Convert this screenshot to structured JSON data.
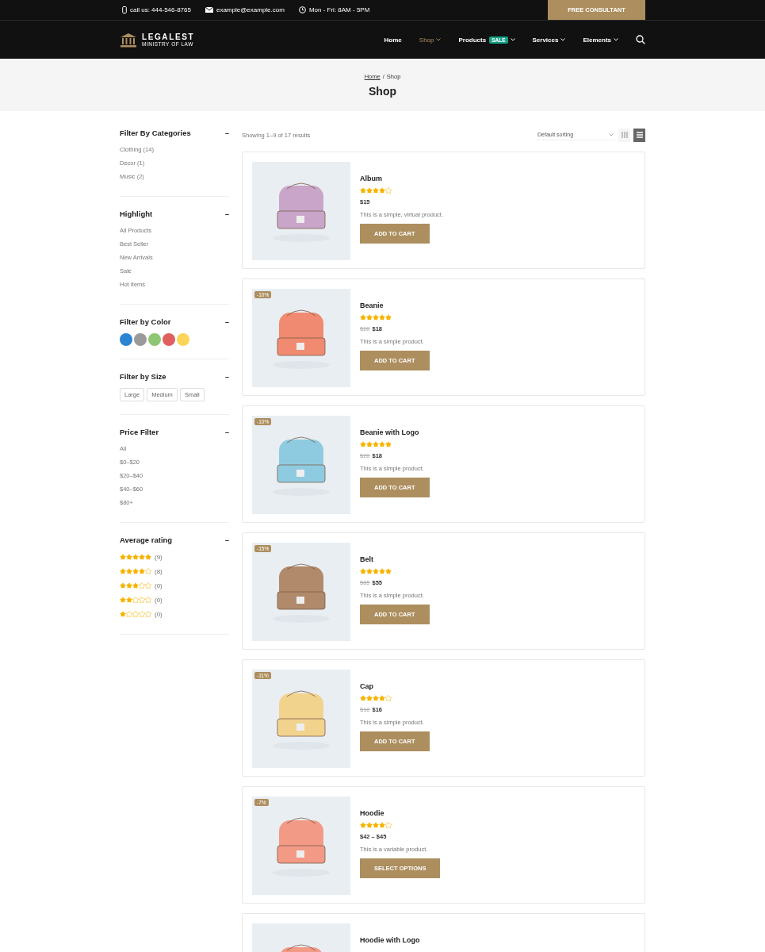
{
  "topbar": {
    "phone": "call us: 444-546-8765",
    "email": "example@example.com",
    "hours": "Mon - Fri: 8AM - 5PM",
    "cta": "FREE CONSULTANT"
  },
  "header": {
    "logo_title": "LEGALEST",
    "logo_subtitle": "MINISTRY OF LAW",
    "nav": [
      {
        "label": "Home",
        "selected": false,
        "dropdown": false
      },
      {
        "label": "Shop",
        "selected": true,
        "dropdown": true
      },
      {
        "label": "Products",
        "selected": false,
        "dropdown": true,
        "badge": "SALE"
      },
      {
        "label": "Services",
        "selected": false,
        "dropdown": true
      },
      {
        "label": "Elements",
        "selected": false,
        "dropdown": true
      }
    ]
  },
  "banner": {
    "breadcrumb": [
      {
        "label": "Home",
        "link": true
      },
      {
        "label": "/",
        "link": false
      },
      {
        "label": "Shop",
        "link": false
      }
    ],
    "title": "Shop"
  },
  "sidebar": [
    {
      "kind": "list",
      "title": "Filter By Categories",
      "toggle": "–",
      "items": [
        "Clothing (14)",
        "Decor (1)",
        "Music (2)"
      ]
    },
    {
      "kind": "list",
      "title": "Highlight",
      "toggle": "–",
      "items": [
        "All Products",
        "Best Seller",
        "New Arrivals",
        "Sale",
        "Hot Items"
      ]
    },
    {
      "kind": "colors",
      "title": "Filter by Color",
      "toggle": "–",
      "colors": [
        {
          "color": "#2b84d2"
        },
        {
          "color": "#9a9a9a"
        },
        {
          "color": "#8ec774"
        },
        {
          "color": "#e06060"
        },
        {
          "color": "#fbd55a"
        }
      ]
    },
    {
      "kind": "sizes",
      "title": "Filter by Size",
      "toggle": "–",
      "items": [
        "Large",
        "Medium",
        "Small"
      ]
    },
    {
      "kind": "list",
      "title": "Price Filter",
      "toggle": "–",
      "items": [
        "All",
        "$0–$20",
        "$20–$40",
        "$40–$60",
        "$80+"
      ]
    },
    {
      "kind": "ratings",
      "title": "Average rating",
      "toggle": "–",
      "ratings": [
        {
          "stars": 5,
          "count": "(9)"
        },
        {
          "stars": 4,
          "count": "(8)"
        },
        {
          "stars": 3,
          "count": "(0)"
        },
        {
          "stars": 2,
          "count": "(0)"
        },
        {
          "stars": 1,
          "count": "(0)"
        }
      ]
    }
  ],
  "toolbar": {
    "results": "Showing 1–9 of 17 results",
    "sorting": "Default sorting",
    "views": [
      {
        "kind": "grid",
        "selected": false
      },
      {
        "kind": "list",
        "selected": true
      }
    ]
  },
  "products": [
    {
      "name": "Album",
      "stars": 4,
      "price": "$15",
      "description": "This is a simple, virtual product.",
      "button": "ADD TO CART"
    },
    {
      "name": "Beanie",
      "badge": "-10%",
      "stars": 5,
      "old_price": "$20",
      "price": "$18",
      "description": "This is a simple product.",
      "button": "ADD TO CART"
    },
    {
      "name": "Beanie with Logo",
      "badge": "-10%",
      "stars": 5,
      "old_price": "$20",
      "price": "$18",
      "description": "This is a simple product.",
      "button": "ADD TO CART"
    },
    {
      "name": "Belt",
      "badge": "-15%",
      "stars": 5,
      "old_price": "$65",
      "price": "$55",
      "description": "This is a simple product.",
      "button": "ADD TO CART"
    },
    {
      "name": "Cap",
      "badge": "-11%",
      "stars": 4,
      "old_price": "$18",
      "price": "$16",
      "description": "This is a simple product.",
      "button": "ADD TO CART"
    },
    {
      "name": "Hoodie",
      "badge": "-7%",
      "stars": 4,
      "price": "$42 – $45",
      "description": "This is a variable product.",
      "button": "SELECT OPTIONS"
    },
    {
      "name": "Hoodie with Logo"
    }
  ]
}
